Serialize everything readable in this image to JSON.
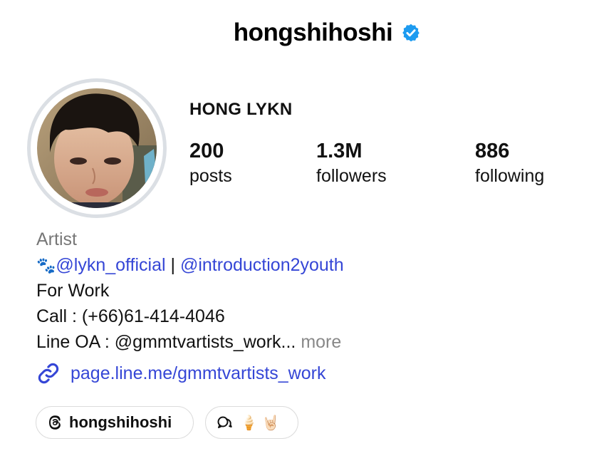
{
  "header": {
    "username": "hongshihoshi",
    "verified_icon": "verified-badge-icon",
    "verified_color": "#1d9bf0"
  },
  "profile": {
    "display_name": "HONG LYKN",
    "avatar_icon": "profile-photo"
  },
  "stats": [
    {
      "value": "200",
      "label": "posts"
    },
    {
      "value": "1.3M",
      "label": "followers"
    },
    {
      "value": "886",
      "label": "following"
    }
  ],
  "bio": {
    "category": "Artist",
    "paw_emoji": "🐾",
    "mention1": "@lykn_official",
    "separator": "|",
    "mention2": "@introduction2youth",
    "line_work": "For Work",
    "line_call": "Call : (+66)61-414-4046",
    "line_lineoa": "Line OA : @gmmtvartists_work...",
    "more": "more",
    "link": "page.line.me/gmmtvartists_work",
    "link_icon": "link-icon",
    "link_color": "#3546d6"
  },
  "chips": {
    "threads_label": "hongshihoshi",
    "threads_icon": "threads-icon",
    "notes_icon": "chat-bubble-icon",
    "notes_emoji": "🍦 🤘🏻"
  }
}
